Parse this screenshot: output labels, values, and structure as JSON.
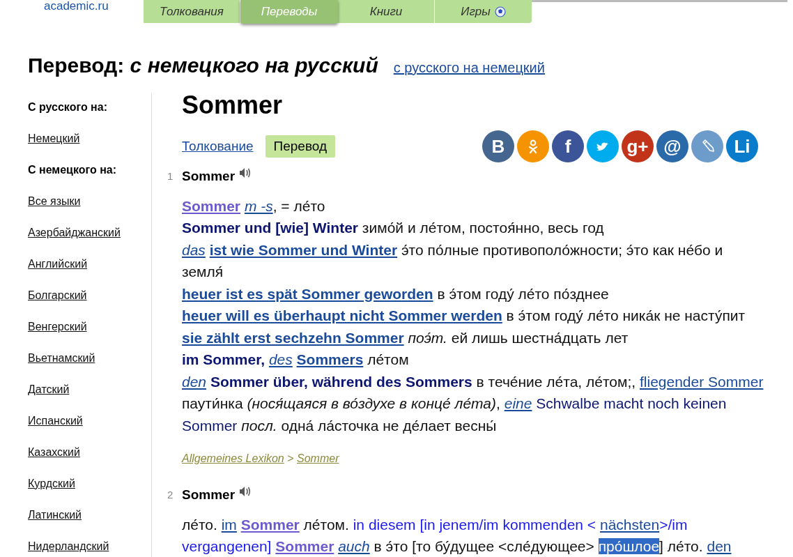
{
  "site": {
    "logo": "academic.ru"
  },
  "nav_tabs": [
    {
      "label": "Толкования",
      "selected": false,
      "icon": false
    },
    {
      "label": "Переводы",
      "selected": true,
      "icon": false
    },
    {
      "label": "Книги",
      "selected": false,
      "icon": false
    },
    {
      "label": "Игры",
      "selected": false,
      "icon": true
    }
  ],
  "heading": {
    "prefix": "Перевод:",
    "direction": "с немецкого на русский",
    "switch_link": "с русского на немецкий"
  },
  "sidebar": {
    "items": [
      {
        "kind": "header",
        "label": "С русского на:"
      },
      {
        "kind": "link",
        "label": "Немецкий"
      },
      {
        "kind": "header",
        "label": "С немецкого на:"
      },
      {
        "kind": "link",
        "label": "Все языки"
      },
      {
        "kind": "link",
        "label": "Азербайджанский"
      },
      {
        "kind": "link",
        "label": "Английский"
      },
      {
        "kind": "link",
        "label": "Болгарский"
      },
      {
        "kind": "link",
        "label": "Венгерский"
      },
      {
        "kind": "link",
        "label": "Вьетнамский"
      },
      {
        "kind": "link",
        "label": "Датский"
      },
      {
        "kind": "link",
        "label": "Испанский"
      },
      {
        "kind": "link",
        "label": "Казахский"
      },
      {
        "kind": "link",
        "label": "Курдский"
      },
      {
        "kind": "link",
        "label": "Латинский"
      },
      {
        "kind": "link",
        "label": "Нидерландский"
      }
    ]
  },
  "word": "Sommer",
  "view_tabs": [
    {
      "label": "Толкование",
      "selected": false
    },
    {
      "label": "Перевод",
      "selected": true
    }
  ],
  "share_buttons": [
    {
      "kind": "glyph",
      "label": "В",
      "color": "#45668e"
    },
    {
      "kind": "person",
      "color": "#f59300"
    },
    {
      "kind": "glyph",
      "label": "f",
      "color": "#3b5598"
    },
    {
      "kind": "bird",
      "color": "#00aced"
    },
    {
      "kind": "glyph",
      "label": "g+",
      "color": "#c23419"
    },
    {
      "kind": "glyph",
      "label": "@",
      "color": "#2a6aa8"
    },
    {
      "kind": "pencil",
      "color": "#6d9ccb"
    },
    {
      "kind": "glyph",
      "label": "Li",
      "color": "#0a7ccb"
    }
  ],
  "entries": [
    {
      "number": "1",
      "headword": "Sommer",
      "lines": [
        [
          {
            "kind": "visited",
            "text": "Sommer"
          },
          {
            "kind": "abbr",
            "text": "m -s"
          },
          {
            "kind": "text",
            "text": ", = ле́то",
            "tight": true
          }
        ],
        [
          {
            "kind": "term",
            "text": "Sommer und [wie] Winter"
          },
          {
            "kind": "text",
            "text": "зимо́й и ле́том, постоя́нно, весь год"
          }
        ],
        [
          {
            "kind": "abbr",
            "text": "das"
          },
          {
            "kind": "term-link",
            "text": "ist wie Sommer und Winter"
          },
          {
            "kind": "text",
            "text": "э́то по́лные противополо́жности; э́то как не́бо и"
          },
          {
            "kind": "text",
            "text": "земля́"
          }
        ],
        [
          {
            "kind": "term-link",
            "text": "heuer ist es spät Sommer geworden"
          },
          {
            "kind": "text",
            "text": "в э́том году́ ле́то по́зднее"
          }
        ],
        [
          {
            "kind": "term-link",
            "text": "heuer will es überhaupt nicht Sommer werden"
          },
          {
            "kind": "text",
            "text": "в э́том году́ ле́то ника́к не насту́пит"
          }
        ],
        [
          {
            "kind": "term-link",
            "text": "sie zählt erst sechzehn Sommer"
          },
          {
            "kind": "italic",
            "text": "поэ́т."
          },
          {
            "kind": "text",
            "text": "ей лишь шестна́дцать лет"
          }
        ],
        [
          {
            "kind": "term",
            "text": "im Sommer,"
          },
          {
            "kind": "abbr",
            "text": "des"
          },
          {
            "kind": "term-link",
            "text": "Sommers"
          },
          {
            "kind": "text",
            "text": "ле́том"
          }
        ],
        [
          {
            "kind": "abbr",
            "text": "den"
          },
          {
            "kind": "term",
            "text": "Sommer über, während des Sommers"
          },
          {
            "kind": "text",
            "text": "в тече́ние ле́та, ле́том;,"
          },
          {
            "kind": "link",
            "text": "fliegender Sommer"
          },
          {
            "kind": "text",
            "text": "паути́нка"
          },
          {
            "kind": "italic",
            "text": "(нося́щаяся в во́здухе в конце́ ле́та)"
          },
          {
            "kind": "text",
            "text": ",",
            "tight": true
          },
          {
            "kind": "abbr",
            "text": "eine"
          },
          {
            "kind": "navy",
            "text": "Schwalbe macht noch keinen"
          },
          {
            "kind": "navy",
            "text": "Sommer"
          },
          {
            "kind": "italic",
            "text": "посл."
          },
          {
            "kind": "text",
            "text": "одна́ ла́сточка не де́лает весны́"
          }
        ]
      ],
      "source": [
        {
          "kind": "link",
          "text": "Allgemeines Lexikon"
        },
        {
          "kind": "sep",
          "text": ">"
        },
        {
          "kind": "link",
          "text": "Sommer"
        }
      ]
    },
    {
      "number": "2",
      "headword": "Sommer",
      "lines": [
        [
          {
            "kind": "text",
            "text": "ле́то."
          },
          {
            "kind": "link",
            "text": "im"
          },
          {
            "kind": "visited",
            "text": "Sommer"
          },
          {
            "kind": "text",
            "text": "ле́том."
          },
          {
            "kind": "blue",
            "text": "in diesem [in jenem/im kommenden <"
          },
          {
            "kind": "link",
            "text": "nächsten"
          },
          {
            "kind": "blue",
            "text": ">/im",
            "tight": true
          },
          {
            "kind": "blue",
            "text": "vergangenen]"
          },
          {
            "kind": "visited",
            "text": "Sommer"
          },
          {
            "kind": "abbr",
            "text": "auch"
          },
          {
            "kind": "text",
            "text": "в э́то [то бу́дущее <сле́дующее>"
          },
          {
            "kind": "selected",
            "text": "про́шлое"
          },
          {
            "kind": "text",
            "text": "] ле́то.",
            "tight": true
          },
          {
            "kind": "link",
            "text": "den"
          }
        ]
      ]
    }
  ]
}
